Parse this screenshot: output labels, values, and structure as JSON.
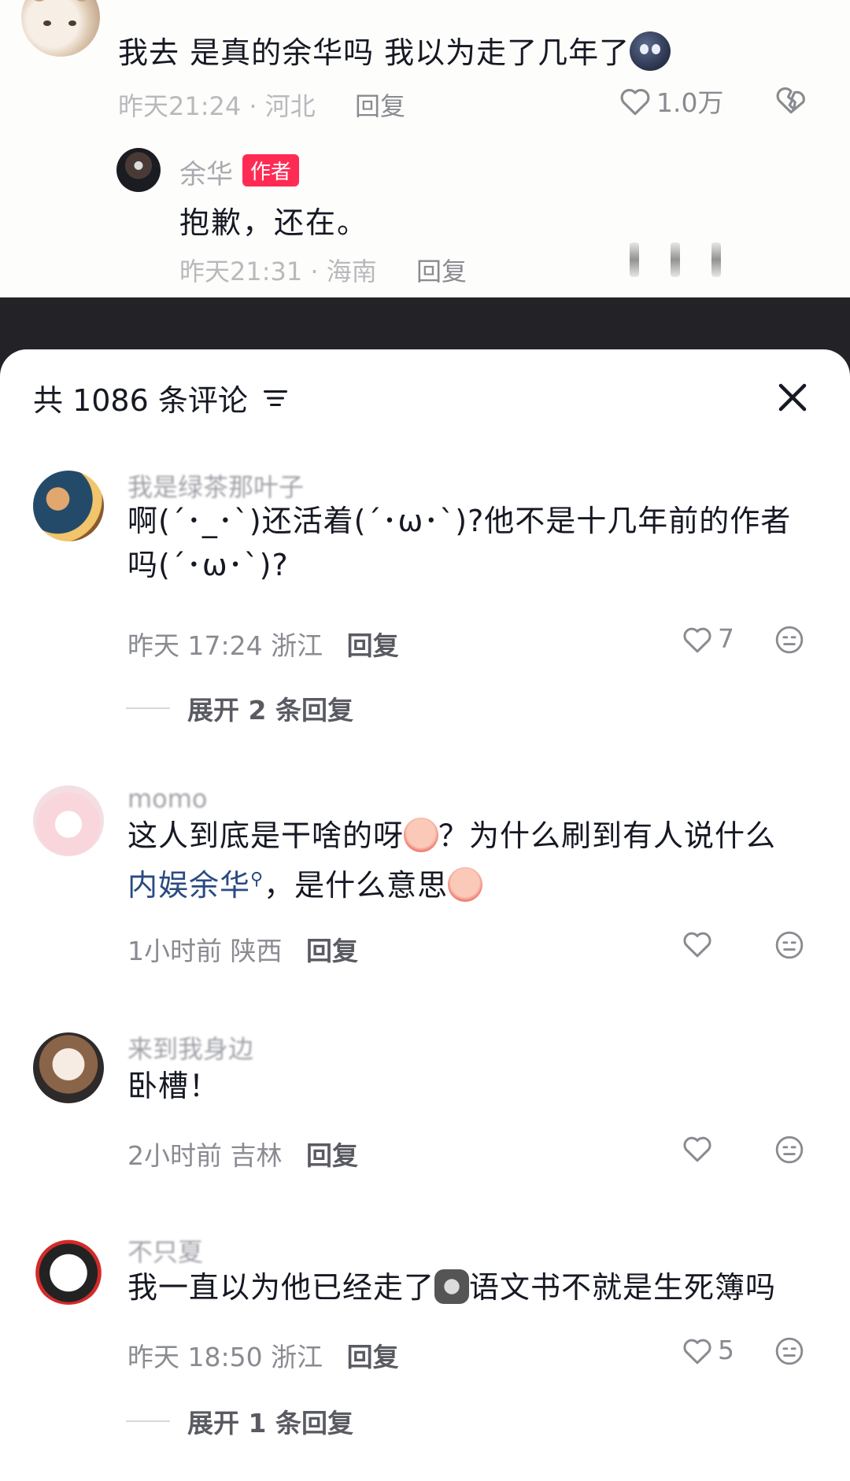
{
  "top_comment": {
    "text": "我去 是真的余华吗 我以为走了几年了",
    "time": "昨天21:24",
    "location": "河北",
    "reply_label": "回复",
    "likes": "1.0万"
  },
  "author_reply": {
    "name": "余华",
    "badge": "作者",
    "text": "抱歉，还在。",
    "time": "昨天21:31",
    "location": "海南",
    "reply_label": "回复"
  },
  "sheet": {
    "header": "共 1086 条评论",
    "close_label": "×"
  },
  "comments": [
    {
      "name": "我是绿茶那叶子",
      "text": "啊(´･_･`)还活着(´･ω･`)?他不是十几年前的作者吗(´･ω･`)?",
      "time": "昨天 17:24",
      "location": "浙江",
      "reply_label": "回复",
      "likes": "7",
      "expand": "展开 2 条回复"
    },
    {
      "name": "momo",
      "text_a": "这人到底是干啥的呀",
      "text_b": "？为什么刷到有人说什么",
      "link": "内娱余华",
      "text_c": "，是什么意思",
      "time": "1小时前",
      "location": "陕西",
      "reply_label": "回复",
      "likes": ""
    },
    {
      "name": "来到我身边",
      "text": "卧槽！",
      "time": "2小时前",
      "location": "吉林",
      "reply_label": "回复",
      "likes": ""
    },
    {
      "name": "不只夏",
      "text_a": "我一直以为他已经走了",
      "text_b": "语文书不就是生死簿吗",
      "time": "昨天 18:50",
      "location": "浙江",
      "reply_label": "回复",
      "likes": "5",
      "expand": "展开 1 条回复"
    }
  ],
  "colors": {
    "accent": "#fe2c55",
    "meta": "#8a8b91",
    "dark_band": "#232327"
  }
}
